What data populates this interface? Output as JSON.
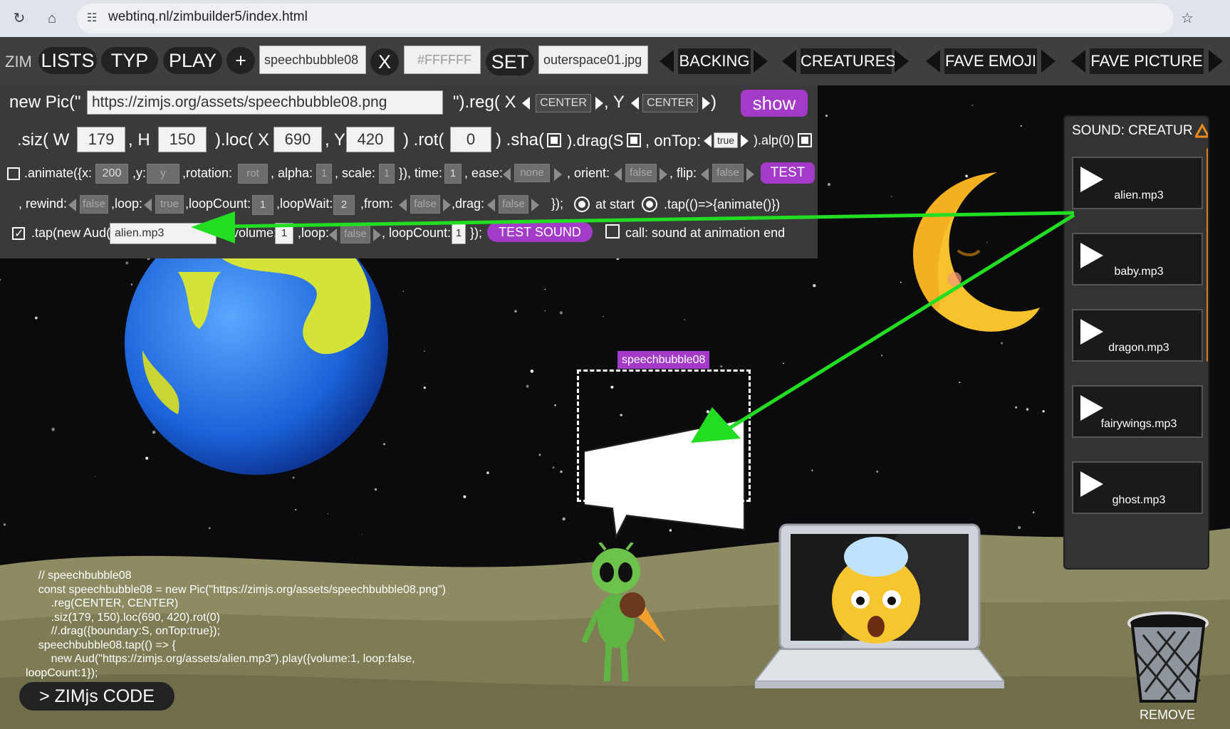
{
  "browser": {
    "url": "webtinq.nl/zimbuilder5/index.html",
    "reload_icon": "reload-icon",
    "home_icon": "home-icon",
    "site_info_icon": "site-info-icon",
    "bookmark_icon": "star-icon"
  },
  "toolbar": {
    "zim": "ZIM",
    "lists": "LISTS",
    "typ": "TYP",
    "play": "PLAY",
    "add": "+",
    "asset_name": "speechbubble08",
    "close": "X",
    "color_placeholder": "#FFFFFF",
    "set": "SET",
    "background_file": "outerspace01.jpg",
    "backing": "BACKING",
    "creatures": "CREATURES",
    "fave_emoji": "FAVE EMOJI",
    "fave_picture": "FAVE PICTURE"
  },
  "builder": {
    "row1": {
      "new_pic": "new Pic(\"",
      "url": "https://zimjs.org/assets/speechbubble08.png",
      "reg": "\").reg( X",
      "reg_x": "CENTER",
      "comma_y": ", Y",
      "reg_y": "CENTER",
      "close": ")",
      "show": "show"
    },
    "row2": {
      "siz": ".siz( W",
      "w": "179",
      "h_label": ", H",
      "h": "150",
      "loc": ").loc( X",
      "x": "690",
      "y_label": ", Y",
      "y": "420",
      "rot": ") .rot(",
      "rot_val": "0",
      "sha": ") .sha(",
      "drag": ").drag(S",
      "ontop": ", onTop:",
      "ontop_val": "true",
      "alp": ").alp(0)"
    },
    "row3": {
      "animate": ".animate({x:",
      "x": "200",
      "y_label": ",y:",
      "y": "y",
      "rotation_label": ",rotation:",
      "rotation": "rot",
      "alpha_label": ", alpha:",
      "alpha": "1",
      "scale_label": ", scale:",
      "scale": "1",
      "time_label": "}), time:",
      "time": "1",
      "ease_label": ", ease:",
      "ease": "none",
      "orient_label": ", orient:",
      "orient": "false",
      "flip_label": ", flip:",
      "flip": "false",
      "test": "TEST"
    },
    "row4": {
      "rewind_label": ", rewind:",
      "rewind": "false",
      "loop_label": ",loop:",
      "loop": "true",
      "loopcount_label": ",loopCount:",
      "loopcount": "1",
      "loopwait_label": ",loopWait:",
      "loopwait": "2",
      "from_label": ",from:",
      "from": "false",
      "drag_label": ",drag:",
      "drag": "false",
      "close": "});",
      "at_start": "at start",
      "tap_animate": ".tap(()=>{animate()})"
    },
    "row5": {
      "tap_aud": ".tap(new Aud(",
      "sound": "alien.mp3",
      "volume_label": "volume:",
      "volume": "1",
      "loop_label": ",loop:",
      "loop": "false",
      "loopcount_label": ", loopCount:",
      "loopcount": "1",
      "close": "});",
      "test_sound": "TEST SOUND",
      "call_end": "call: sound at animation end"
    }
  },
  "sound_panel": {
    "title": "SOUND: CREATUR",
    "items": [
      {
        "name": "alien.mp3"
      },
      {
        "name": "baby.mp3"
      },
      {
        "name": "dragon.mp3"
      },
      {
        "name": "fairywings.mp3"
      },
      {
        "name": "ghost.mp3"
      }
    ]
  },
  "canvas": {
    "bubble_label": "speechbubble08",
    "code_lines": [
      "    // speechbubble08",
      "    const speechbubble08 = new Pic(\"https://zimjs.org/assets/speechbubble08.png\")",
      "        .reg(CENTER, CENTER)",
      "        .siz(179, 150).loc(690, 420).rot(0)",
      "        //.drag({boundary:S, onTop:true});",
      "    speechbubble08.tap(() => {",
      "        new Aud(\"https://zimjs.org/assets/alien.mp3\").play({volume:1, loop:false,",
      "loopCount:1});"
    ],
    "zim_code_button": "> ZIMjs CODE",
    "remove_label": "REMOVE"
  },
  "colors": {
    "accent_purple": "#a43ac8",
    "arrow_green": "#22dd22",
    "panel_gray": "#3a3a3a",
    "ground": "#8d8b62"
  }
}
